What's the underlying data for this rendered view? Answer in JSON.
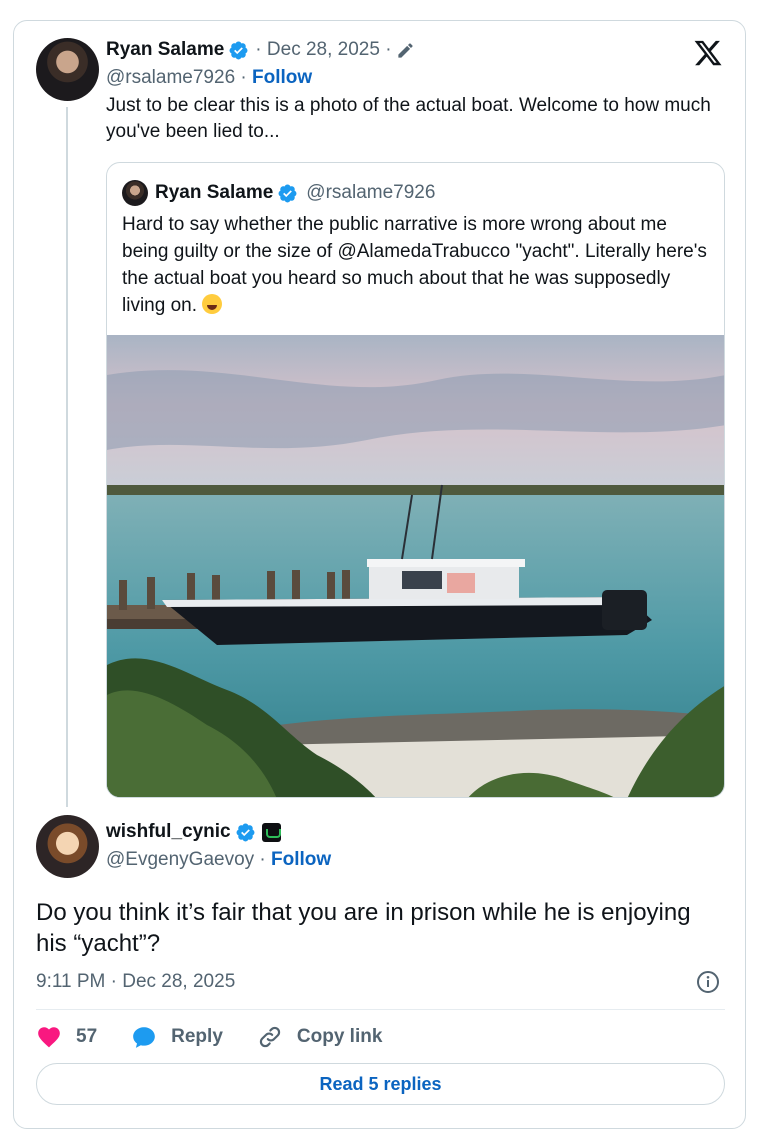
{
  "colors": {
    "accent": "#1d9bf0",
    "link": "#0b64c0",
    "text": "#0f1419",
    "muted": "#536471",
    "border": "#cfd9de",
    "like": "#f91880"
  },
  "parent": {
    "name": "Ryan Salame",
    "date": "· Dec 28, 2025 ·",
    "handle": "@rsalame7926",
    "separator": "·",
    "follow_label": "Follow",
    "text": "Just to be clear this is a photo of the actual boat. Welcome to how much you've been lied to...",
    "icons": [
      "verified-icon",
      "pencil-icon",
      "x-logo-icon"
    ]
  },
  "quote": {
    "name": "Ryan Salame",
    "handle": "@rsalame7926",
    "text": "Hard to say whether the public narrative is more wrong about me being guilty or the size of @AlamedaTrabucco \"yacht\". Literally here's the actual boat you heard so much about that he was supposedly living on.",
    "emoji": "laughing-crying-emoji",
    "media": "photo-of-boat"
  },
  "reply": {
    "name": "wishful_cynic",
    "handle": "@EvgenyGaevoy",
    "separator": "·",
    "follow_label": "Follow",
    "text": "Do you think it’s fair that you are in prison while he is enjoying his “yacht”?",
    "timestamp": "9:11 PM · Dec 28, 2025"
  },
  "actions": {
    "like_count": "57",
    "reply_label": "Reply",
    "copy_label": "Copy link"
  },
  "read_replies_label": "Read 5 replies"
}
